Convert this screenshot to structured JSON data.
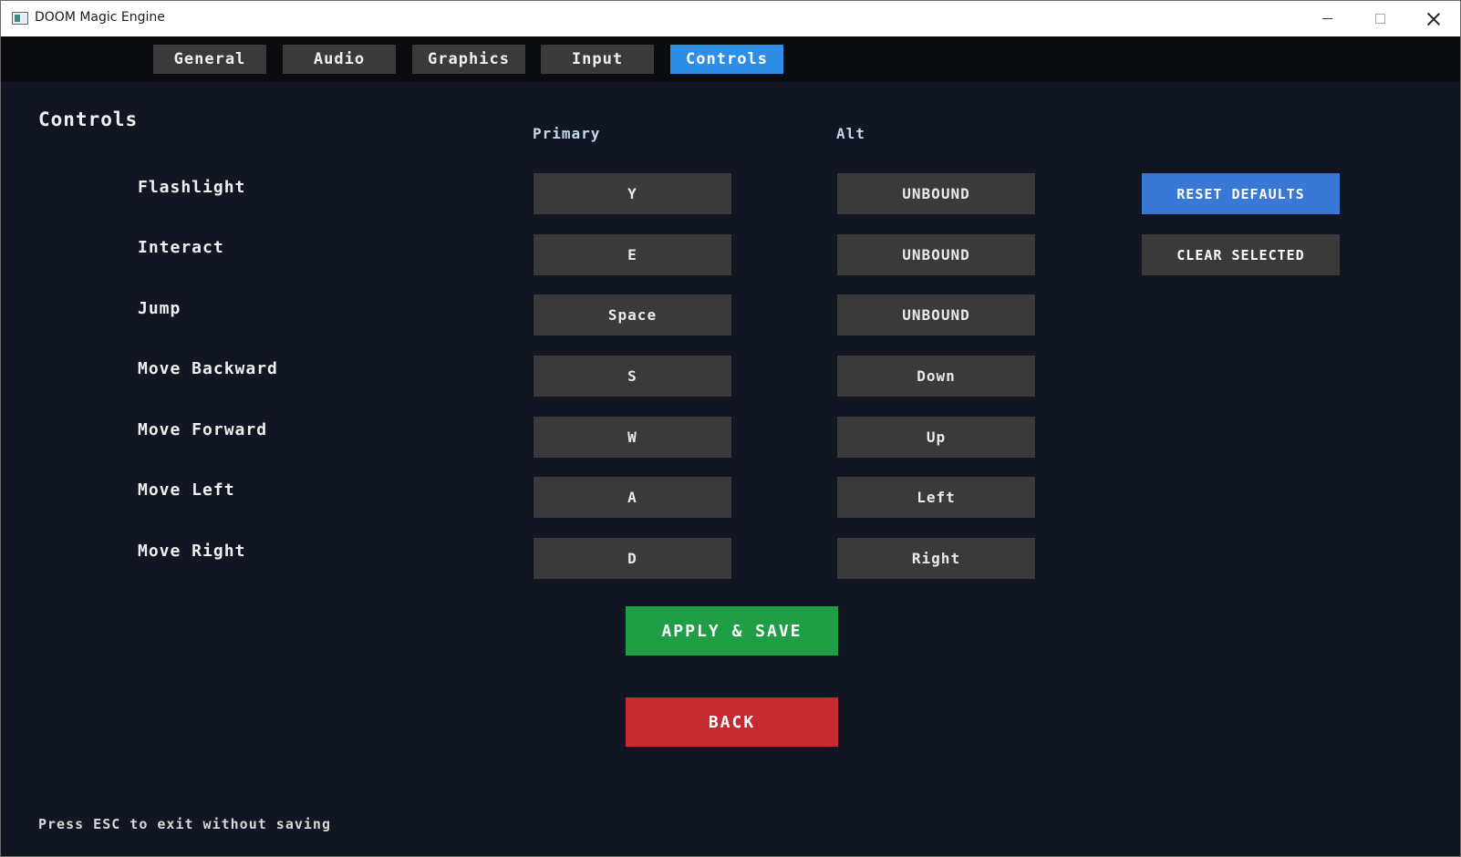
{
  "window": {
    "title": "DOOM Magic Engine",
    "icon": "app-window-icon"
  },
  "tabs": [
    {
      "label": "General",
      "active": false
    },
    {
      "label": "Audio",
      "active": false
    },
    {
      "label": "Graphics",
      "active": false
    },
    {
      "label": "Input",
      "active": false
    },
    {
      "label": "Controls",
      "active": true
    }
  ],
  "page": {
    "title": "Controls",
    "primary_header": "Primary",
    "alt_header": "Alt"
  },
  "bindings": [
    {
      "action": "Flashlight",
      "primary": "Y",
      "alt": "UNBOUND"
    },
    {
      "action": "Interact",
      "primary": "E",
      "alt": "UNBOUND"
    },
    {
      "action": "Jump",
      "primary": "Space",
      "alt": "UNBOUND"
    },
    {
      "action": "Move Backward",
      "primary": "S",
      "alt": "Down"
    },
    {
      "action": "Move Forward",
      "primary": "W",
      "alt": "Up"
    },
    {
      "action": "Move Left",
      "primary": "A",
      "alt": "Left"
    },
    {
      "action": "Move Right",
      "primary": "D",
      "alt": "Right"
    }
  ],
  "actions": {
    "reset_defaults": "RESET DEFAULTS",
    "clear_selected": "CLEAR SELECTED",
    "apply_save": "APPLY & SAVE",
    "back": "BACK"
  },
  "footer": {
    "hint": "Press ESC to exit without saving"
  },
  "colors": {
    "accent": "#2e8ee6",
    "reset": "#3a78d6",
    "apply": "#1f9e45",
    "back": "#c52a30",
    "neutral": "#3a3a3a"
  }
}
